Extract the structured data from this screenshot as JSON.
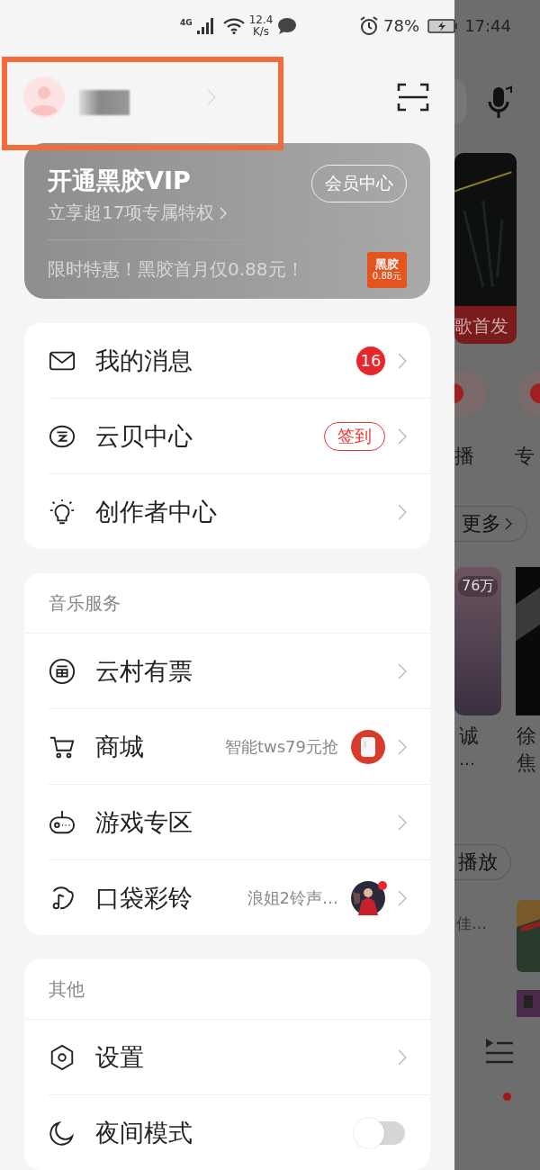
{
  "status_bar": {
    "network": "4G",
    "speed": "12.4",
    "speed_unit": "K/s",
    "battery": "78%",
    "time": "17:44"
  },
  "vip": {
    "title": "开通黑胶VIP",
    "subtitle": "立享超17项专属特权",
    "button": "会员中心",
    "promo": "限时特惠！黑胶首月仅0.88元！",
    "badge_top": "黑胶",
    "badge_bottom": "0.88元"
  },
  "sections": [
    {
      "items": [
        {
          "kind": "count",
          "label": "我的消息",
          "badge": "16"
        },
        {
          "kind": "tag",
          "label": "云贝中心",
          "tag": "签到"
        },
        {
          "kind": "plain",
          "label": "创作者中心"
        }
      ]
    },
    {
      "title": "音乐服务",
      "items": [
        {
          "kind": "plain",
          "label": "云村有票"
        },
        {
          "kind": "promo",
          "label": "商城",
          "note": "智能tws79元抢"
        },
        {
          "kind": "plain",
          "label": "游戏专区"
        },
        {
          "kind": "promo",
          "label": "口袋彩铃",
          "note": "浪姐2铃声…",
          "dot": true
        }
      ]
    },
    {
      "title": "其他",
      "items": [
        {
          "kind": "plain",
          "label": "设置"
        },
        {
          "kind": "toggle",
          "label": "夜间模式",
          "on": false
        }
      ]
    }
  ],
  "background": {
    "banner_label": "歌首发",
    "shortcuts": [
      "播",
      "专"
    ],
    "more": "更多",
    "play_count": "76万",
    "card_1_line_1": "诚",
    "card_1_line_2": "…",
    "card_2_line_1": "徐",
    "card_2_line_2": "焦",
    "play_all": "播放",
    "song_line": "佳…"
  }
}
